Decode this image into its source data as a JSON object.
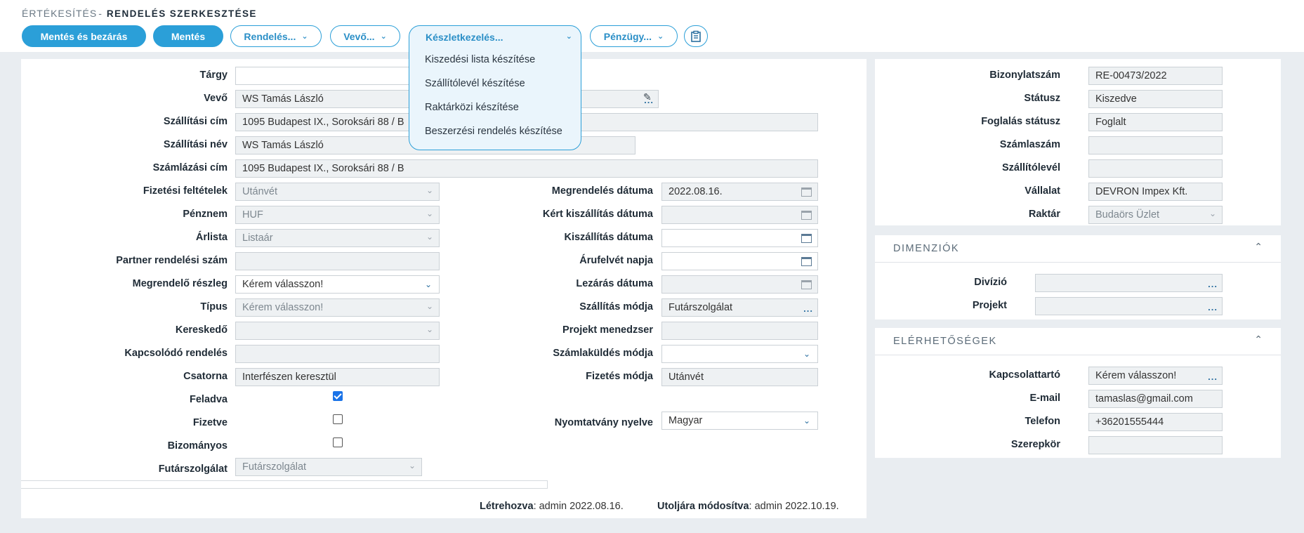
{
  "breadcrumb": {
    "parent": "ÉRTÉKESÍTÉS",
    "separator": "-",
    "page": "RENDELÉS SZERKESZTÉSE"
  },
  "toolbar": {
    "save_close": "Mentés és bezárás",
    "save": "Mentés",
    "order": "Rendelés...",
    "customer": "Vevő...",
    "inventory": "Készletkezelés...",
    "finance": "Pénzügy..."
  },
  "inventory_menu": {
    "items": [
      "Kiszedési lista készítése",
      "Szállítólevél készítése",
      "Raktárközi készítése",
      "Beszerzési rendelés készítése"
    ]
  },
  "form": {
    "subject": {
      "label": "Tárgy",
      "value": ""
    },
    "customer": {
      "label": "Vevő",
      "value": "WS  Tamás László"
    },
    "ship_address": {
      "label": "Szállítási cím",
      "value": "1095 Budapest IX., Soroksári 88 / B"
    },
    "ship_name": {
      "label": "Szállítási név",
      "value": "WS  Tamás László"
    },
    "bill_address": {
      "label": "Számlázási cím",
      "value": "1095 Budapest IX., Soroksári 88 / B"
    },
    "payment_terms": {
      "label": "Fizetési feltételek",
      "value": "Utánvét"
    },
    "currency": {
      "label": "Pénznem",
      "value": "HUF"
    },
    "price_list": {
      "label": "Árlista",
      "value": "Listaár"
    },
    "partner_order_no": {
      "label": "Partner rendelési szám",
      "value": ""
    },
    "ordering_dept": {
      "label": "Megrendelő részleg",
      "value": "Kérem válasszon!"
    },
    "type": {
      "label": "Típus",
      "value": "Kérem válasszon!"
    },
    "salesperson": {
      "label": "Kereskedő",
      "value": ""
    },
    "related_order": {
      "label": "Kapcsolódó rendelés",
      "value": ""
    },
    "channel": {
      "label": "Csatorna",
      "value": "Interfészen keresztül"
    },
    "posted": {
      "label": "Feladva",
      "checked": true
    },
    "paid": {
      "label": "Fizetve",
      "checked": false
    },
    "consignment": {
      "label": "Bizományos",
      "checked": false
    },
    "courier": {
      "label": "Futárszolgálat",
      "value": "Futárszolgálat"
    },
    "order_date": {
      "label": "Megrendelés dátuma",
      "value": "2022.08.16."
    },
    "req_delivery_date": {
      "label": "Kért kiszállítás dátuma",
      "value": ""
    },
    "delivery_date": {
      "label": "Kiszállítás dátuma",
      "value": ""
    },
    "receipt_day": {
      "label": "Árufelvét napja",
      "value": ""
    },
    "close_date": {
      "label": "Lezárás dátuma",
      "value": ""
    },
    "ship_method": {
      "label": "Szállítás módja",
      "value": "Futárszolgálat"
    },
    "project_manager": {
      "label": "Projekt menedzser",
      "value": ""
    },
    "invoice_send": {
      "label": "Számlaküldés módja",
      "value": ""
    },
    "pay_method": {
      "label": "Fizetés módja",
      "value": "Utánvét"
    },
    "print_lang": {
      "label": "Nyomtatvány nyelve",
      "value": "Magyar"
    }
  },
  "footer": {
    "created_label": "Létrehozva",
    "created_value": ": admin 2022.08.16.",
    "modified_label": "Utoljára módosítva",
    "modified_value": ": admin 2022.10.19."
  },
  "doc": {
    "doc_no": {
      "label": "Bizonylatszám",
      "value": "RE-00473/2022"
    },
    "status": {
      "label": "Státusz",
      "value": "Kiszedve"
    },
    "reservation": {
      "label": "Foglalás státusz",
      "value": "Foglalt"
    },
    "invoice_no": {
      "label": "Számlaszám",
      "value": ""
    },
    "delivery_note": {
      "label": "Szállítólevél",
      "value": ""
    },
    "company": {
      "label": "Vállalat",
      "value": "DEVRON Impex Kft."
    },
    "warehouse": {
      "label": "Raktár",
      "value": "Budaörs Üzlet"
    }
  },
  "dimensions": {
    "title": "DIMENZIÓK",
    "division": {
      "label": "Divízió",
      "value": ""
    },
    "project": {
      "label": "Projekt",
      "value": ""
    }
  },
  "contacts": {
    "title": "ELÉRHETŐSÉGEK",
    "contact": {
      "label": "Kapcsolattartó",
      "value": "Kérem válasszon!"
    },
    "email": {
      "label": "E-mail",
      "value": "tamaslas@gmail.com"
    },
    "phone": {
      "label": "Telefon",
      "value": "+36201555444"
    },
    "role": {
      "label": "Szerepkör",
      "value": ""
    }
  },
  "icons": {
    "chevron": "chevron-down-icon",
    "print": "clipboard-print-icon",
    "edit": "edit-icon",
    "calendar": "calendar-icon"
  },
  "colors": {
    "accent": "#2b9fd8",
    "background": "#e9edf1"
  }
}
